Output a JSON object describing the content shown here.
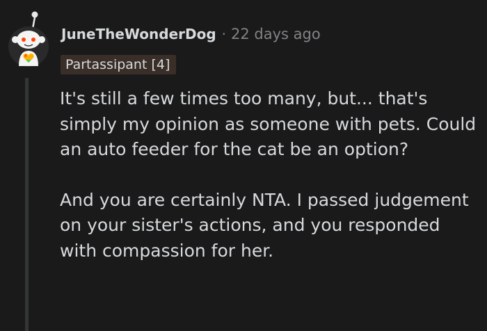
{
  "comment": {
    "username": "JuneTheWonderDog",
    "separator": "·",
    "timestamp": "22 days ago",
    "flair": "Partassipant [4]",
    "paragraphs": [
      "It's still a few times too many, but... that's simply my opinion as someone with pets. Could an auto feeder for the cat be an option?",
      "And you are certainly NTA. I passed judgement on your sister's actions, and you responded with compassion for her."
    ]
  },
  "colors": {
    "background": "#1a1a1b",
    "text": "#d7dadc",
    "meta_text": "#818384",
    "flair_background": "#3a2f28",
    "thread_line": "#343536"
  },
  "icons": {
    "avatar": "snoo-avatar-icon"
  }
}
